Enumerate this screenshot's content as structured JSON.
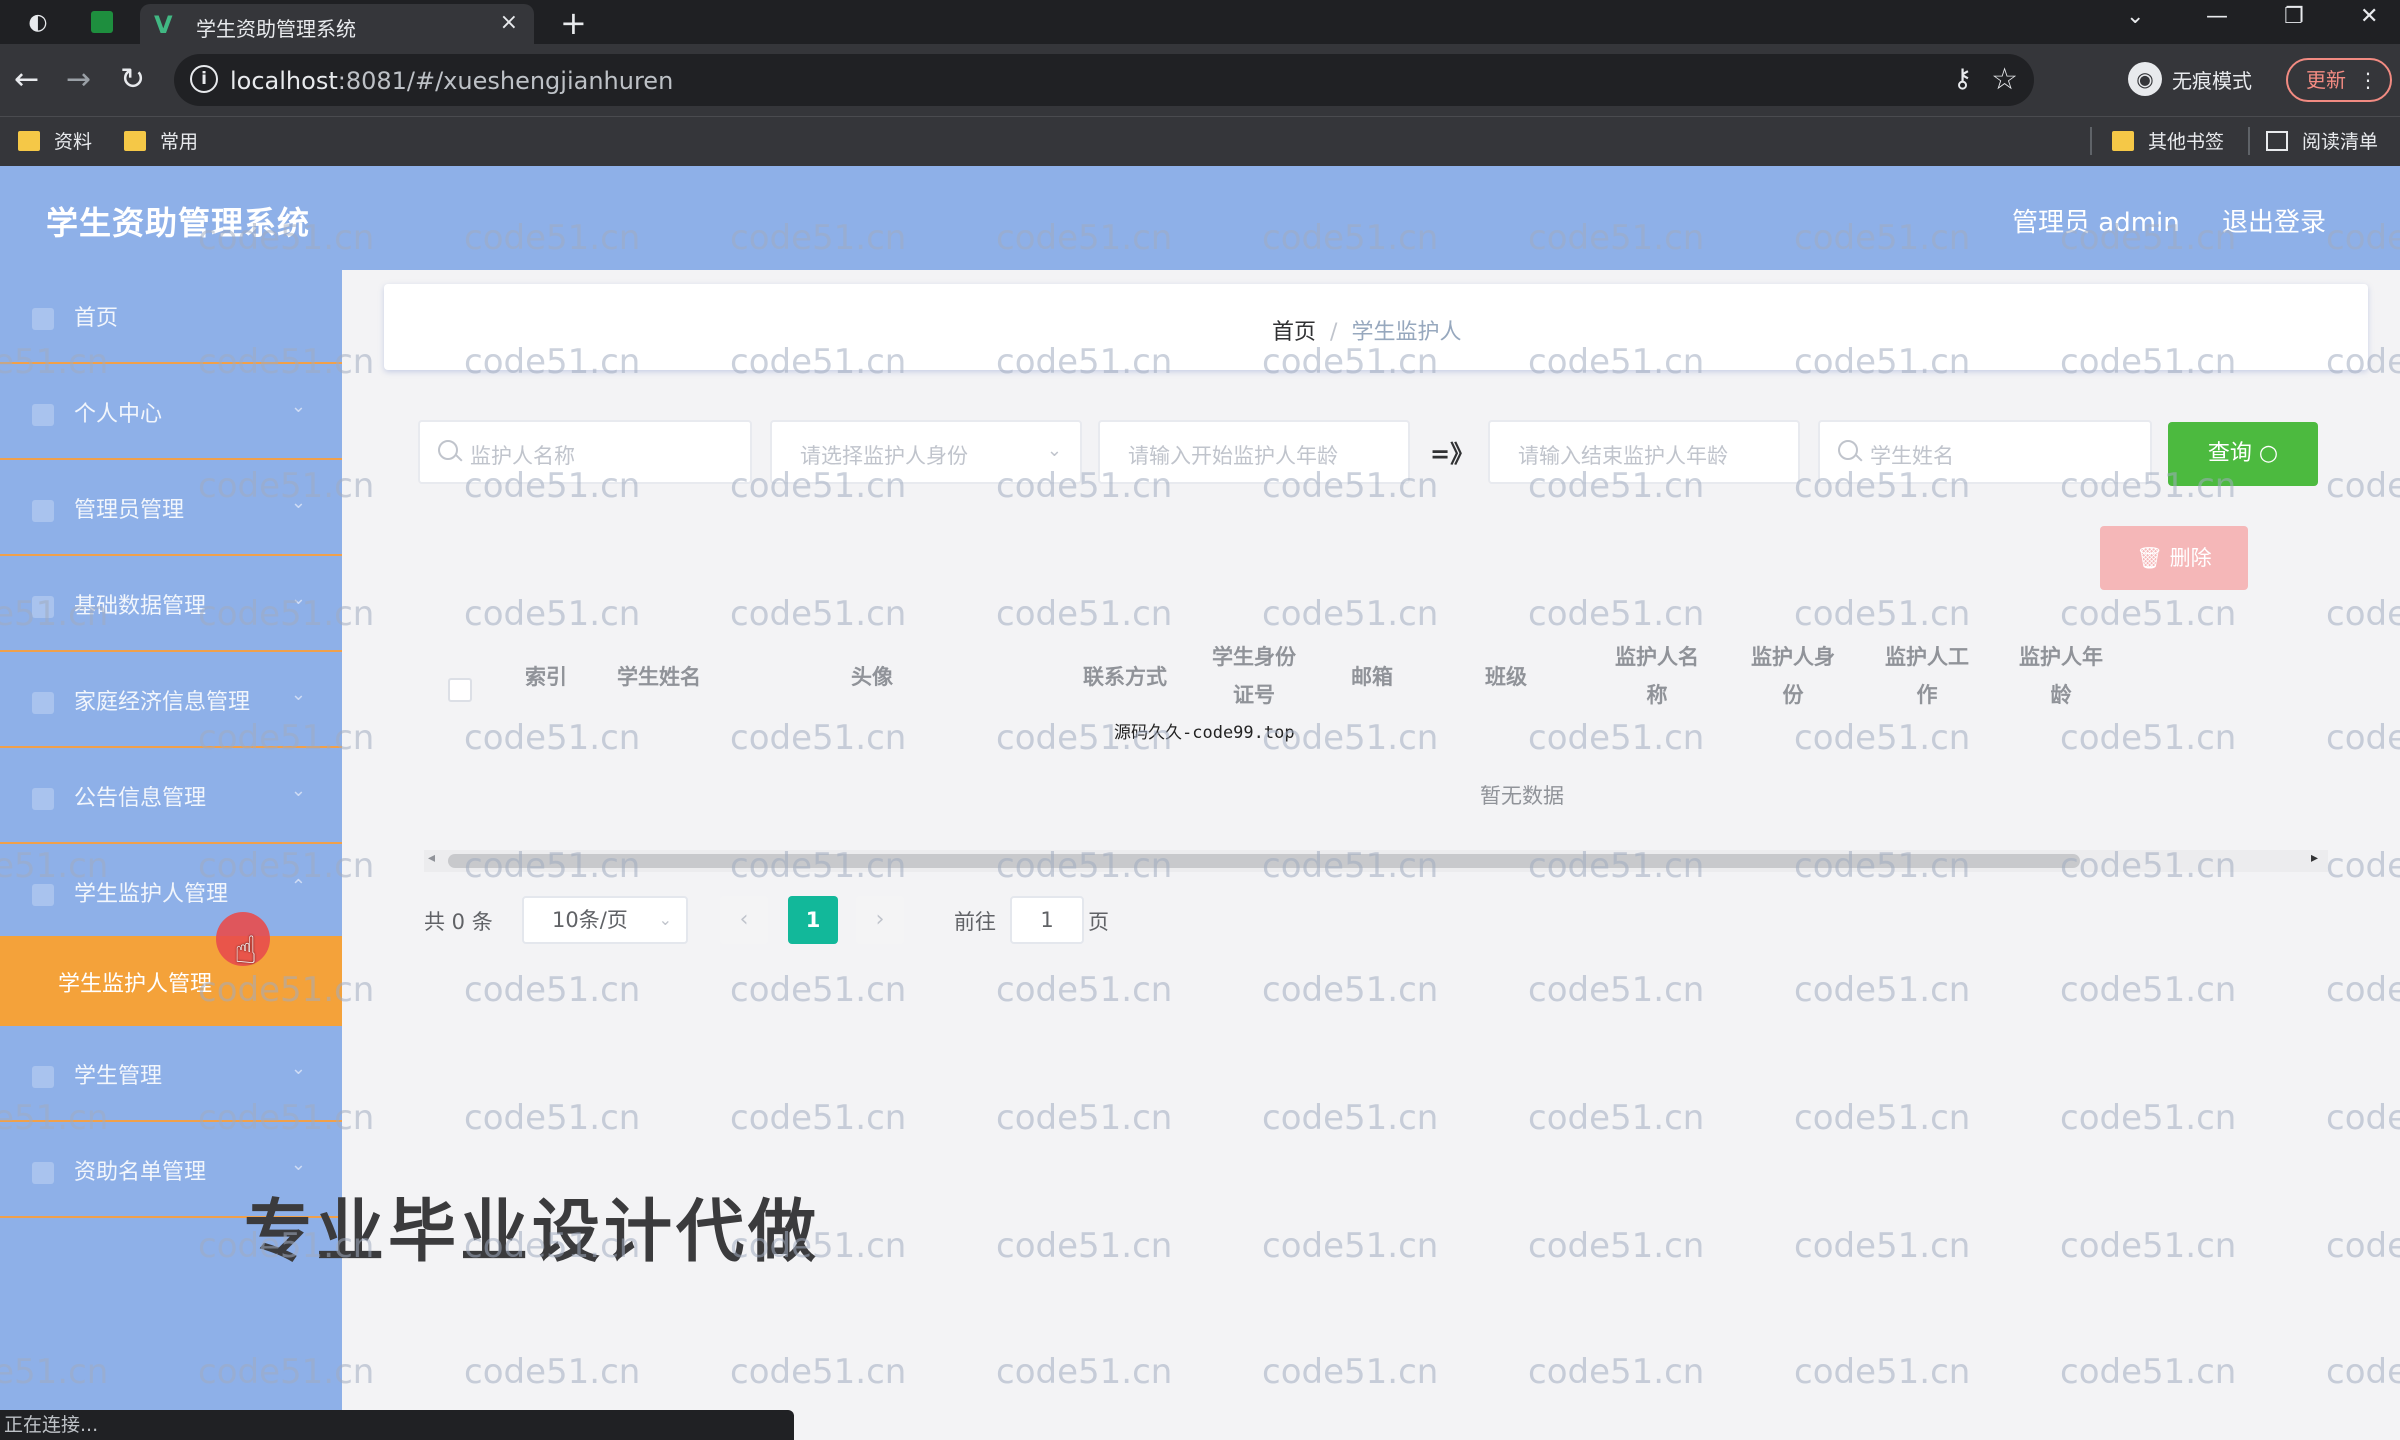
{
  "browser": {
    "tab_title": "学生资助管理系统",
    "tab_close": "×",
    "new_tab": "+",
    "url_host": "localhost",
    "url_rest": ":8081/#/xueshengjianhuren",
    "incognito_label": "无痕模式",
    "update_label": "更新",
    "bookmarks": [
      "资料",
      "常用"
    ],
    "other_bookmarks": "其他书签",
    "reading_list": "阅读清单",
    "status_text": "正在连接..."
  },
  "header": {
    "title": "学生资助管理系统",
    "admin": "管理员 admin",
    "logout": "退出登录"
  },
  "sidebar": {
    "items": [
      {
        "label": "首页"
      },
      {
        "label": "个人中心"
      },
      {
        "label": "管理员管理"
      },
      {
        "label": "基础数据管理"
      },
      {
        "label": "家庭经济信息管理"
      },
      {
        "label": "公告信息管理"
      },
      {
        "label": "学生监护人管理"
      },
      {
        "label": "学生管理"
      },
      {
        "label": "资助名单管理"
      }
    ],
    "active_sub": "学生监护人管理"
  },
  "breadcrumb": {
    "home": "首页",
    "sep": "/",
    "current": "学生监护人"
  },
  "search": {
    "guardian_name": "监护人名称",
    "guardian_identity": "请选择监护人身份",
    "age_start": "请输入开始监护人年龄",
    "range_sep": "=》",
    "age_end": "请输入结束监护人年龄",
    "student_name": "学生姓名",
    "query_label": "查询"
  },
  "toolbar": {
    "delete_label": "删除"
  },
  "table": {
    "columns": [
      "索引",
      "学生姓名",
      "头像",
      "联系方式",
      "学生身份证号",
      "邮箱",
      "班级",
      "监护人名称",
      "监护人身份",
      "监护人工作",
      "监护人年龄"
    ],
    "empty_text": "暂无数据"
  },
  "pagination": {
    "total": "共 0 条",
    "page_size": "10条/页",
    "prev": "‹",
    "current_page": "1",
    "next": "›",
    "goto_prefix": "前往",
    "goto_value": "1",
    "goto_suffix": "页"
  },
  "overlay": {
    "center_watermark": "源码久久-code99.top",
    "promo": "专业毕业设计代做",
    "watermark": "code51.cn"
  }
}
